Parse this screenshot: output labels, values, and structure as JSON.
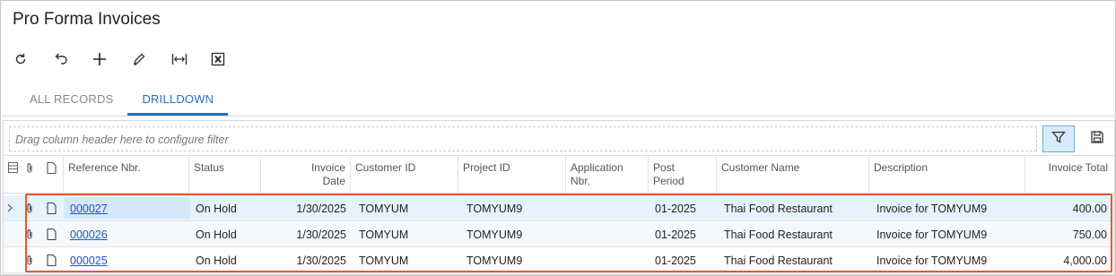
{
  "page": {
    "title": "Pro Forma Invoices"
  },
  "toolbar": {
    "buttons": [
      {
        "name": "refresh-button",
        "icon": "refresh-icon"
      },
      {
        "name": "undo-button",
        "icon": "undo-icon"
      },
      {
        "name": "add-button",
        "icon": "plus-icon"
      },
      {
        "name": "edit-button",
        "icon": "pencil-icon"
      },
      {
        "name": "fit-columns-button",
        "icon": "fit-width-icon"
      },
      {
        "name": "export-excel-button",
        "icon": "excel-icon"
      }
    ]
  },
  "tabs": [
    {
      "label": "ALL RECORDS",
      "active": false
    },
    {
      "label": "DRILLDOWN",
      "active": true
    }
  ],
  "grid": {
    "filter_placeholder": "Drag column header here to configure filter",
    "columns": [
      {
        "key": "reference_nbr",
        "label": "Reference Nbr."
      },
      {
        "key": "status",
        "label": "Status"
      },
      {
        "key": "invoice_date",
        "label": "Invoice Date",
        "line1": "Invoice",
        "line2": "Date"
      },
      {
        "key": "customer_id",
        "label": "Customer ID"
      },
      {
        "key": "project_id",
        "label": "Project ID"
      },
      {
        "key": "application_nbr",
        "label": "Application Nbr.",
        "line1": "Application",
        "line2": "Nbr."
      },
      {
        "key": "post_period",
        "label": "Post Period",
        "line1": "Post",
        "line2": "Period"
      },
      {
        "key": "customer_name",
        "label": "Customer Name"
      },
      {
        "key": "description",
        "label": "Description"
      },
      {
        "key": "invoice_total",
        "label": "Invoice Total"
      }
    ],
    "rows": [
      {
        "reference_nbr": "000027",
        "status": "On Hold",
        "invoice_date": "1/30/2025",
        "customer_id": "TOMYUM",
        "project_id": "TOMYUM9",
        "application_nbr": "",
        "post_period": "01-2025",
        "customer_name": "Thai Food Restaurant",
        "description": "Invoice for TOMYUM9",
        "invoice_total": "400.00",
        "selected": true
      },
      {
        "reference_nbr": "000026",
        "status": "On Hold",
        "invoice_date": "1/30/2025",
        "customer_id": "TOMYUM",
        "project_id": "TOMYUM9",
        "application_nbr": "",
        "post_period": "01-2025",
        "customer_name": "Thai Food Restaurant",
        "description": "Invoice for TOMYUM9",
        "invoice_total": "750.00",
        "selected": false
      },
      {
        "reference_nbr": "000025",
        "status": "On Hold",
        "invoice_date": "1/30/2025",
        "customer_id": "TOMYUM",
        "project_id": "TOMYUM9",
        "application_nbr": "",
        "post_period": "01-2025",
        "customer_name": "Thai Food Restaurant",
        "description": "Invoice for TOMYUM9",
        "invoice_total": "4,000.00",
        "selected": false
      }
    ]
  },
  "colors": {
    "accent": "#2a6fb8",
    "link": "#2052c8",
    "highlight": "#e8582a",
    "selected_row": "#e7f2fc"
  }
}
